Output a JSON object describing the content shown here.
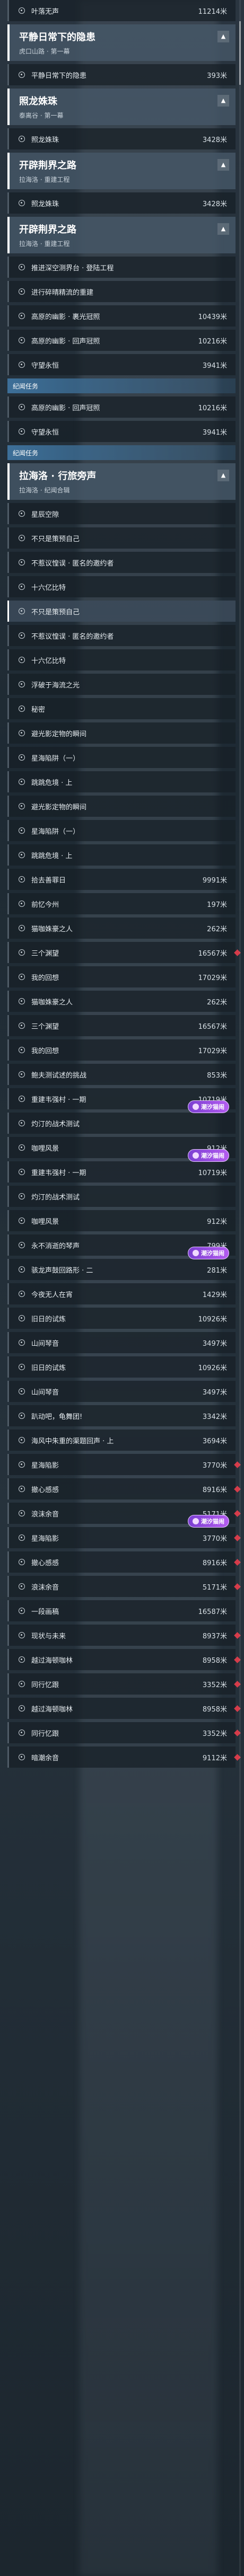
{
  "list": [
    {
      "k": "row",
      "name": "叶落无声",
      "dist": "11214米"
    },
    {
      "k": "head",
      "title": "平静日常下的隐患",
      "sub": "虎口山路 · 第一幕",
      "chev": "▲"
    },
    {
      "k": "row",
      "name": "平静日常下的隐患",
      "dist": "393米"
    },
    {
      "k": "head",
      "title": "照龙姝珠",
      "sub": "泰离谷 · 第一幕",
      "chev": "▲"
    },
    {
      "k": "row",
      "name": "照龙姝珠",
      "dist": "3428米"
    },
    {
      "k": "head",
      "title": "开辟荆界之路",
      "sub": "拉海洛 · 重建工程",
      "chev": "▲"
    },
    {
      "k": "row",
      "name": "照龙姝珠",
      "dist": "3428米"
    },
    {
      "k": "head",
      "title": "开辟荆界之路",
      "sub": "拉海洛 · 重建工程",
      "chev": "▲"
    },
    {
      "k": "row",
      "name": "推进深空测界台 · 登陆工程",
      "dist": ""
    },
    {
      "k": "row",
      "name": "进行碎晴精流的重建",
      "dist": ""
    },
    {
      "k": "row",
      "name": "高原的幽影 · 裹光冠照",
      "dist": "10439米"
    },
    {
      "k": "row",
      "name": "高原的幽影 · 回声冠照",
      "dist": "10216米"
    },
    {
      "k": "row",
      "name": "守望永恒",
      "dist": "3941米"
    },
    {
      "k": "cat",
      "label": "纪闻任务"
    },
    {
      "k": "row",
      "name": "高原的幽影 · 回声冠照",
      "dist": "10216米"
    },
    {
      "k": "row",
      "name": "守望永恒",
      "dist": "3941米"
    },
    {
      "k": "cat",
      "label": "纪闻任务"
    },
    {
      "k": "head",
      "title": "拉海洛 · 行旅旁声",
      "sub": "拉海洛 · 纪闻合辑",
      "chev": "▲"
    },
    {
      "k": "row",
      "name": "星辰空隙",
      "dist": ""
    },
    {
      "k": "row",
      "name": "不只是策预自己",
      "dist": ""
    },
    {
      "k": "row",
      "name": "不惹议惶误 · 匿名的邀约者",
      "dist": ""
    },
    {
      "k": "row",
      "name": "十六亿比特",
      "dist": ""
    },
    {
      "k": "row",
      "name": "不只是策预自己",
      "dist": "",
      "sel": true
    },
    {
      "k": "row",
      "name": "不惹议惶误 · 匿名的邀约者",
      "dist": ""
    },
    {
      "k": "row",
      "name": "十六亿比特",
      "dist": ""
    },
    {
      "k": "row",
      "name": "浮破于海流之光",
      "dist": ""
    },
    {
      "k": "row",
      "name": "秘密",
      "dist": ""
    },
    {
      "k": "row",
      "name": "避光影定物的瞬间",
      "dist": ""
    },
    {
      "k": "row",
      "name": "星海陷阱（一）",
      "dist": ""
    },
    {
      "k": "row",
      "name": "跳跳危境 · 上",
      "dist": ""
    },
    {
      "k": "row",
      "name": "避光影定物的瞬间",
      "dist": ""
    },
    {
      "k": "row",
      "name": "星海陷阱（一）",
      "dist": ""
    },
    {
      "k": "row",
      "name": "跳跳危境 · 上",
      "dist": ""
    },
    {
      "k": "row",
      "name": "拾去善罪日",
      "dist": "9991米"
    },
    {
      "k": "row",
      "name": "前忆今州",
      "dist": "197米"
    },
    {
      "k": "row",
      "name": "猫咖姝豪之人",
      "dist": "262米"
    },
    {
      "k": "row",
      "name": "三个渊望",
      "dist": "16567米",
      "diamond": true
    },
    {
      "k": "row",
      "name": "我的回想",
      "dist": "17029米"
    },
    {
      "k": "row",
      "name": "猫咖姝豪之人",
      "dist": "262米"
    },
    {
      "k": "row",
      "name": "三个渊望",
      "dist": "16567米"
    },
    {
      "k": "row",
      "name": "我的回想",
      "dist": "17029米"
    },
    {
      "k": "row",
      "name": "鲍夫测试述的挑战",
      "dist": "853米"
    },
    {
      "k": "row",
      "name": "重建韦强村 · 一期",
      "dist": "10719米"
    },
    {
      "k": "row",
      "name": "灼汀的战术测试",
      "dist": ""
    },
    {
      "k": "row",
      "name": "咖哩风景",
      "dist": "912米"
    },
    {
      "k": "row",
      "name": "重建韦强村 · 一期",
      "dist": "10719米"
    },
    {
      "k": "row",
      "name": "灼汀的战术测试",
      "dist": ""
    },
    {
      "k": "row",
      "name": "咖哩风景",
      "dist": "912米"
    },
    {
      "k": "row",
      "name": "永不消逝的琴声",
      "dist": "799米"
    },
    {
      "k": "row",
      "name": "骇龙声鼓回路形 · 二",
      "dist": "281米"
    },
    {
      "k": "row",
      "name": "今夜无人在宵",
      "dist": "1429米"
    },
    {
      "k": "row",
      "name": "旧日的试炼",
      "dist": "10926米"
    },
    {
      "k": "row",
      "name": "山间琴音",
      "dist": "3497米"
    },
    {
      "k": "row",
      "name": "旧日的试炼",
      "dist": "10926米"
    },
    {
      "k": "row",
      "name": "山间琴音",
      "dist": "3497米"
    },
    {
      "k": "row",
      "name": "趴动吧，龟舞团!",
      "dist": "3342米"
    },
    {
      "k": "row",
      "name": "海风中朱重的渠题回声 · 上",
      "dist": "3694米"
    },
    {
      "k": "row",
      "name": "星海陷影",
      "dist": "3770米",
      "diamond": true
    },
    {
      "k": "row",
      "name": "撤心感感",
      "dist": "8916米",
      "diamond": true
    },
    {
      "k": "row",
      "name": "浪沫余音",
      "dist": "5171米",
      "diamond": true
    },
    {
      "k": "row",
      "name": "星海陷影",
      "dist": "3770米",
      "diamond": true
    },
    {
      "k": "row",
      "name": "撤心感感",
      "dist": "8916米",
      "diamond": true
    },
    {
      "k": "row",
      "name": "浪沫余音",
      "dist": "5171米",
      "diamond": true
    },
    {
      "k": "row",
      "name": "一段画稿",
      "dist": "16587米"
    },
    {
      "k": "row",
      "name": "现状与未来",
      "dist": "8937米",
      "diamond": true
    },
    {
      "k": "row",
      "name": "越过海顿咖林",
      "dist": "8958米",
      "diamond": true
    },
    {
      "k": "row",
      "name": "同行忆跟",
      "dist": "3352米",
      "diamond": true
    },
    {
      "k": "row",
      "name": "越过海顿咖林",
      "dist": "8958米",
      "diamond": true
    },
    {
      "k": "row",
      "name": "同行忆跟",
      "dist": "3352米",
      "diamond": true
    },
    {
      "k": "row",
      "name": "暗潮余音",
      "dist": "9112米",
      "diamond": true
    }
  ],
  "badges": [
    {
      "text": "潮汐猫闹",
      "at": 47
    },
    {
      "text": "潮汐猫闹",
      "at": 49
    },
    {
      "text": "潮汐猫闹",
      "at": 53
    },
    {
      "text": "潮汐猫闹",
      "at": 64
    },
    {
      "text": "潮汐猫闹",
      "at": 82
    },
    {
      "text": "潮汐猫闹",
      "at": 86
    }
  ],
  "icons": {
    "row_dot": "circle-target-icon",
    "chevron": "chevron-up-icon",
    "badge": "tide-event-icon",
    "marker": "red-diamond-marker-icon"
  }
}
